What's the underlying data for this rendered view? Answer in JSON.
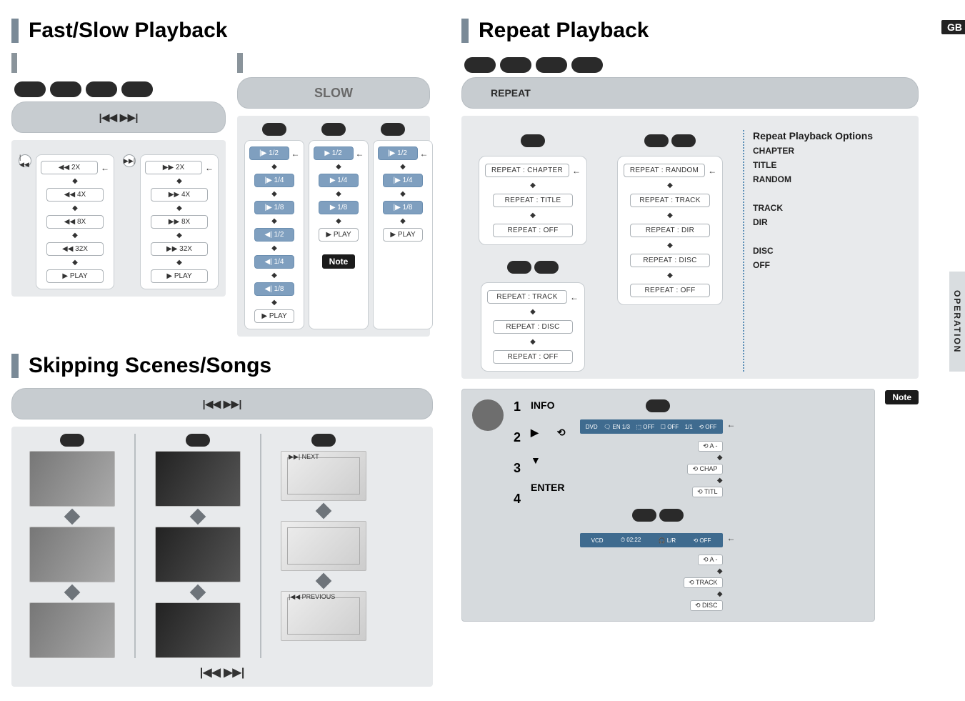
{
  "page_badge": "GB",
  "side_tab": "OPERATION",
  "sections": {
    "fast_slow": {
      "title": "Fast/Slow Playback",
      "bar_label": "|◀◀  ▶▶|",
      "slow_title": "SLOW",
      "note_label": "Note",
      "rewind": [
        "◀◀  2X",
        "◀◀  4X",
        "◀◀  8X",
        "◀◀  32X",
        "▶  PLAY"
      ],
      "forward": [
        "▶▶  2X",
        "▶▶  4X",
        "▶▶  8X",
        "▶▶  32X",
        "▶  PLAY"
      ],
      "slow_col1": [
        "|▶  1/2",
        "|▶  1/4",
        "|▶  1/8",
        "◀|  1/2",
        "◀|  1/4",
        "◀|  1/8",
        "▶  PLAY"
      ],
      "slow_col2": [
        "▶  1/2",
        "▶  1/4",
        "▶  1/8",
        "▶  PLAY"
      ],
      "slow_col3": [
        "|▶  1/2",
        "|▶  1/4",
        "|▶  1/8",
        "▶  PLAY"
      ]
    },
    "skipping": {
      "title": "Skipping Scenes/Songs",
      "bar_label": "|◀◀  ▶▶|",
      "footer_label": "|◀◀  ▶▶|",
      "next_label": "▶▶| NEXT",
      "prev_label": "|◀◀ PREVIOUS"
    },
    "repeat": {
      "title": "Repeat Playback",
      "bar_label": "REPEAT",
      "note_label": "Note",
      "col_dvd": [
        "REPEAT : CHAPTER",
        "REPEAT : TITLE",
        "REPEAT : OFF"
      ],
      "col_cd": [
        "REPEAT : TRACK",
        "REPEAT : DISC",
        "REPEAT : OFF"
      ],
      "col_mp3": [
        "REPEAT : RANDOM",
        "REPEAT : TRACK",
        "REPEAT : DIR",
        "REPEAT : DISC",
        "REPEAT : OFF"
      ],
      "options_title": "Repeat Playback Options",
      "options": [
        "CHAPTER",
        "TITLE",
        "RANDOM",
        "TRACK",
        "DIR",
        "DISC",
        "OFF"
      ],
      "steps": {
        "nums": [
          "1",
          "2",
          "3",
          "4"
        ],
        "labels": [
          "INFO",
          "▶",
          "▼",
          "ENTER"
        ],
        "repeat_glyph": "⟲",
        "osd1": [
          "DVD",
          "🗨 EN 1/3",
          "⬚ OFF",
          "☐ OFF",
          "1/1",
          "⟲ OFF"
        ],
        "osd1_flow": [
          "⟲ A -",
          "⟲ CHAP",
          "⟲ TITL"
        ],
        "osd2": [
          "VCD",
          "⏱ 02:22",
          "🎧 L/R",
          "⟲ OFF"
        ],
        "osd2_flow": [
          "⟲ A -",
          "⟲ TRACK",
          "⟲ DISC"
        ]
      }
    }
  }
}
